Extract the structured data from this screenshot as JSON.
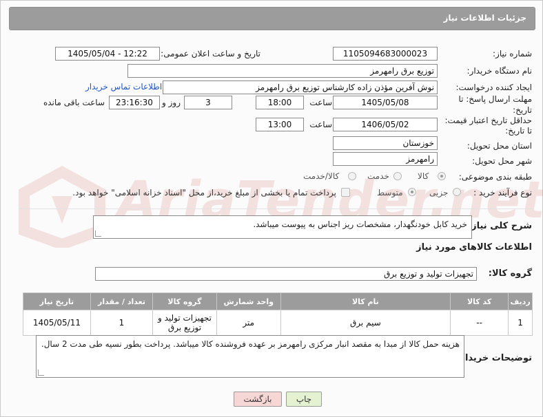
{
  "header": {
    "title": "جزئیات اطلاعات نیاز"
  },
  "watermark": {
    "text": "AriaTender.net"
  },
  "need": {
    "number_label": "شماره نیاز:",
    "number": "1105094683000023",
    "announce_label": "تاریخ و ساعت اعلان عمومی:",
    "announce_value": "1405/05/04 - 12:22",
    "buyer_org_label": "نام دستگاه خریدار:",
    "buyer_org": "توزیع برق رامهرمز",
    "requester_label": "ایجاد کننده درخواست:",
    "requester": "نوش آفرین مؤذن زاده کارشناس توزیع برق رامهرمز",
    "contact_link": "اطلاعات تماس خریدار",
    "deadline_label_1": "مهلت ارسال پاسخ: تا",
    "deadline_label_2": "تاریخ:",
    "deadline_date": "1405/05/08",
    "time_label": "ساعت",
    "deadline_time": "18:00",
    "days_value": "3",
    "days_label": "روز و",
    "remaining_time": "23:16:30",
    "remaining_label": "ساعت باقی مانده",
    "price_label_1": "حداقل تاریخ اعتبار قیمت:",
    "price_label_2": "تا تاریخ:",
    "price_date": "1406/05/02",
    "price_time": "13:00",
    "province_label": "استان محل تحویل:",
    "province": "خوزستان",
    "city_label": "شهر محل تحویل:",
    "city": "رامهرمز",
    "category_label": "طبقه بندی موضوعی:",
    "category_options": [
      "کالا",
      "خدمت",
      "کالا/خدمت"
    ],
    "category_selected": "کالا",
    "process_label": "نوع فرآیند خرید :",
    "process_options": [
      "جزیی",
      "متوسط"
    ],
    "process_selected": "متوسط",
    "payment_note": "پرداخت تمام یا بخشی از مبلغ خرید،از محل \"اسناد خزانه اسلامی\" خواهد بود."
  },
  "description": {
    "label": "شرح کلی نیاز:",
    "text": "خرید کابل خودنگهدار، مشخصات ریز اجناس به پیوست میباشد."
  },
  "goods": {
    "section_title": "اطلاعات کالاهای مورد نیاز",
    "group_label": "گروه کالا:",
    "group_value": "تجهیزات تولید و توزیع برق",
    "columns": [
      "ردیف",
      "کد کالا",
      "نام کالا",
      "واحد شمارش",
      "گروه کالا",
      "تعداد / مقدار",
      "تاریخ نیاز"
    ],
    "rows": [
      [
        "1",
        "--",
        "سیم برق",
        "متر",
        "تجهیزات تولید و توزیع برق",
        "1",
        "1405/05/11"
      ]
    ]
  },
  "buyer_notes": {
    "label": "توضیحات خریدار:",
    "text": "هزینه حمل کالا از مبدا به مقصد انبار مرکزی رامهرمز بر عهده فروشنده کالا میباشد. پرداخت بطور نسیه طی مدت 2 سال."
  },
  "buttons": {
    "print": "چاپ",
    "back": "بازگشت"
  },
  "colors": {
    "header_bg": "#9c9c9c",
    "link": "#1f56c9",
    "back_btn": "#f7d6d6",
    "print_btn": "#e4f2d2"
  }
}
